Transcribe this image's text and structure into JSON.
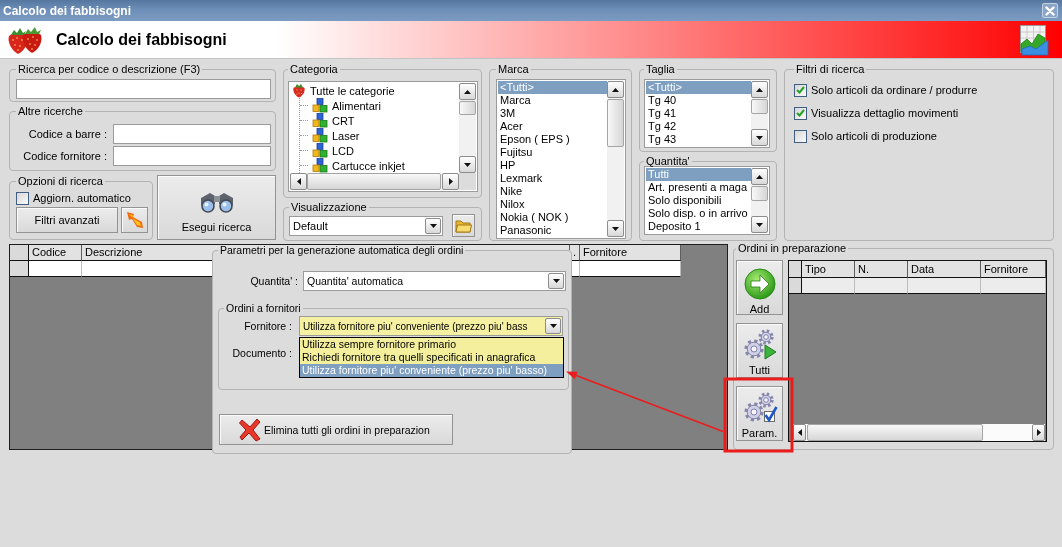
{
  "window": {
    "title": "Calcolo dei fabbisogni"
  },
  "header": {
    "title": "Calcolo dei fabbisogni"
  },
  "search": {
    "label": "Ricerca per codice o descrizione (F3)"
  },
  "other_searches": {
    "label": "Altre ricerche",
    "fields": [
      {
        "label": "Codice a barre :"
      },
      {
        "label": "Codice fornitore :"
      }
    ]
  },
  "search_options": {
    "label": "Opzioni di ricerca",
    "auto_update": {
      "label": "Aggiorn. automatico",
      "checked": false
    },
    "advanced_filters_button": "Filtri avanzati"
  },
  "run_search_button": "Esegui ricerca",
  "category": {
    "label": "Categoria",
    "tree": [
      {
        "label": "Tutte le categorie",
        "children": [
          {
            "label": "Alimentari"
          },
          {
            "label": "CRT"
          },
          {
            "label": "Laser"
          },
          {
            "label": "LCD"
          },
          {
            "label": "Cartucce inkjet"
          }
        ]
      }
    ]
  },
  "display": {
    "label": "Visualizzazione",
    "value": "Default"
  },
  "brand": {
    "label": "Marca",
    "items": [
      {
        "label": "<Tutti>",
        "selected": true
      },
      {
        "label": "Marca",
        "selected": false
      },
      {
        "label": "3M",
        "selected": false
      },
      {
        "label": "Acer",
        "selected": false
      },
      {
        "label": "Epson ( EPS )",
        "selected": false
      },
      {
        "label": "Fujitsu",
        "selected": false
      },
      {
        "label": "HP",
        "selected": false
      },
      {
        "label": "Lexmark",
        "selected": false
      },
      {
        "label": "Nike",
        "selected": false
      },
      {
        "label": "Nilox",
        "selected": false
      },
      {
        "label": "Nokia ( NOK )",
        "selected": false
      },
      {
        "label": "Panasonic",
        "selected": false
      }
    ]
  },
  "size": {
    "label": "Taglia",
    "items": [
      {
        "label": "<Tutti>",
        "selected": true
      },
      {
        "label": "Tg 40",
        "selected": false
      },
      {
        "label": "Tg 41",
        "selected": false
      },
      {
        "label": "Tg 42",
        "selected": false
      },
      {
        "label": "Tg 43",
        "selected": false
      }
    ]
  },
  "quantity": {
    "label": "Quantita'",
    "items": [
      {
        "label": "Tutti",
        "selected": true
      },
      {
        "label": "Art. presenti a maga",
        "selected": false
      },
      {
        "label": "Solo disponibili",
        "selected": false
      },
      {
        "label": "Solo disp. o in arrivo",
        "selected": false
      },
      {
        "label": "Deposito 1",
        "selected": false
      }
    ]
  },
  "search_filters": {
    "label": "Filtri di ricerca",
    "options": [
      {
        "label": "Solo articoli da ordinare / produrre",
        "checked": true
      },
      {
        "label": "Visualizza dettaglio movimenti",
        "checked": true
      },
      {
        "label": "Solo articoli di produzione",
        "checked": false
      }
    ]
  },
  "results_table": {
    "columns": [
      "Codice",
      "Descrizione",
      ".",
      "Fornitore"
    ]
  },
  "parameters_panel": {
    "title": "Parametri per la generazione automatica degli ordini",
    "quantity": {
      "label": "Quantita' :",
      "value": "Quantita' automatica"
    },
    "supplier_orders": {
      "label": "Ordini a fornitori",
      "supplier": {
        "label": "Fornitore :",
        "value": "Utilizza fornitore piu' conveniente (prezzo piu' bass",
        "expanded": true,
        "options": [
          {
            "label": "Utilizza sempre fornitore primario",
            "selected": false
          },
          {
            "label": "Richiedi fornitore tra quelli specificati in anagrafica",
            "selected": false
          },
          {
            "label": "Utilizza fornitore piu' conveniente (prezzo piu' basso)",
            "selected": true
          }
        ]
      },
      "document": {
        "label": "Documento :"
      }
    },
    "delete_button": "Elimina tutti gli ordini in preparazion"
  },
  "orders_in_preparation": {
    "label": "Ordini in preparazione",
    "buttons": [
      {
        "kind": "add",
        "label": "Add",
        "highlighted": false
      },
      {
        "kind": "all",
        "label": "Tutti",
        "highlighted": false
      },
      {
        "kind": "params",
        "label": "Param.",
        "highlighted": true
      }
    ],
    "table": {
      "columns": [
        "Tipo",
        "N.",
        "Data",
        "Fornitore"
      ]
    }
  }
}
